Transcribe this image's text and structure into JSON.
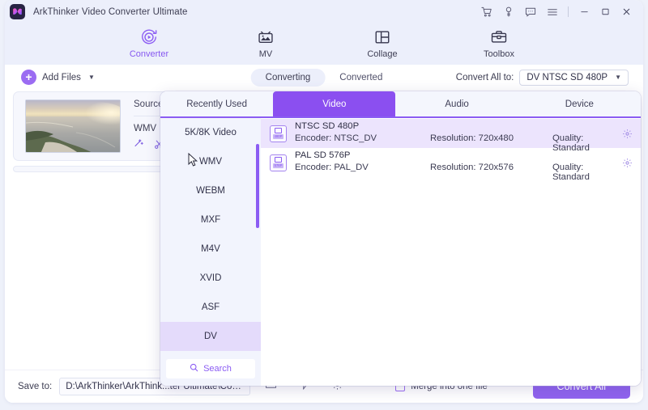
{
  "window": {
    "title": "ArkThinker Video Converter Ultimate",
    "logo_icon": "arkthinker-logo-icon"
  },
  "titlebar": {
    "icons": [
      {
        "name": "cart-icon",
        "label": "Cart"
      },
      {
        "name": "key-icon",
        "label": "Register"
      },
      {
        "name": "feedback-icon",
        "label": "Feedback"
      },
      {
        "name": "menu-icon",
        "label": "Menu"
      }
    ],
    "window_controls": [
      {
        "name": "minimize-button",
        "label": "Minimize"
      },
      {
        "name": "maximize-button",
        "label": "Maximize"
      },
      {
        "name": "close-button",
        "label": "Close"
      }
    ]
  },
  "mainnav": {
    "items": [
      {
        "label": "Converter",
        "icon": "converter-icon",
        "active": true
      },
      {
        "label": "MV",
        "icon": "mv-icon",
        "active": false
      },
      {
        "label": "Collage",
        "icon": "collage-icon",
        "active": false
      },
      {
        "label": "Toolbox",
        "icon": "toolbox-icon",
        "active": false
      }
    ]
  },
  "toolbar": {
    "add_files_label": "Add Files",
    "add_files_caret": "▼",
    "segments": [
      {
        "label": "Converting",
        "active": true
      },
      {
        "label": "Converted",
        "active": false
      }
    ],
    "convert_all_label": "Convert All to:",
    "convert_all_value": "DV NTSC SD 480P",
    "convert_all_caret": "▼"
  },
  "filecard": {
    "source_label": "Source",
    "format_label": "WMV",
    "thumbnail_icon": "coast-sunset-thumbnail",
    "action_icons": [
      {
        "name": "magic-wand-icon"
      },
      {
        "name": "scissors-icon"
      }
    ]
  },
  "popup": {
    "tabs": [
      {
        "label": "Recently Used",
        "active": false
      },
      {
        "label": "Video",
        "active": true
      },
      {
        "label": "Audio",
        "active": false
      },
      {
        "label": "Device",
        "active": false
      }
    ],
    "categories": [
      {
        "label": "5K/8K Video",
        "selected": false
      },
      {
        "label": "WMV",
        "selected": false
      },
      {
        "label": "WEBM",
        "selected": false
      },
      {
        "label": "MXF",
        "selected": false
      },
      {
        "label": "M4V",
        "selected": false
      },
      {
        "label": "XVID",
        "selected": false
      },
      {
        "label": "ASF",
        "selected": false
      },
      {
        "label": "DV",
        "selected": true
      }
    ],
    "search_label": "Search",
    "search_icon": "search-icon",
    "formats": [
      {
        "name": "NTSC SD 480P",
        "encoder": "Encoder: NTSC_DV",
        "resolution": "Resolution: 720x480",
        "quality": "Quality: Standard",
        "badge": "480P",
        "selected": true
      },
      {
        "name": "PAL SD 576P",
        "encoder": "Encoder: PAL_DV",
        "resolution": "Resolution: 720x576",
        "quality": "Quality: Standard",
        "badge": "576P",
        "selected": false
      }
    ]
  },
  "bottombar": {
    "save_to_label": "Save to:",
    "save_to_value": "D:\\ArkThinker\\ArkThink...ter Ultimate\\Converted",
    "icons": [
      {
        "name": "folder-icon"
      },
      {
        "name": "gpu-accel-icon"
      },
      {
        "name": "settings-icon"
      }
    ],
    "merge_label": "Merge into one file",
    "convert_button_label": "Convert All"
  },
  "colors": {
    "accent": "#8b5cf3",
    "accent_dark": "#8b4ff0",
    "chrome": "#eceffb",
    "selected_row": "#ece4fd",
    "selected_cat": "#e4dbfb",
    "page_bg": "#eef1fa"
  }
}
